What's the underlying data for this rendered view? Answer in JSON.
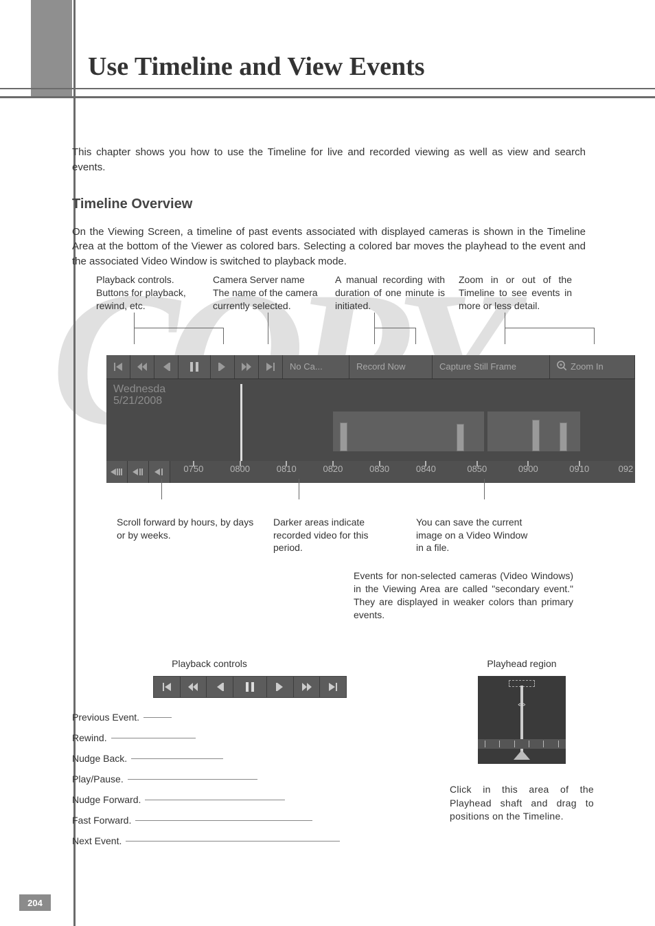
{
  "page": {
    "number": "204",
    "title": "Use Timeline and View Events",
    "watermark": "COPY"
  },
  "intro": "This chapter shows you how to use the Timeline for live and recorded viewing as well as view and search events.",
  "section": {
    "heading": "Timeline Overview",
    "body": "On the Viewing Screen, a timeline of past events associated with displayed cameras is shown in the Timeline Area at the bottom of the Viewer as colored bars. Selecting a colored bar moves the playhead to the event and the associated Video Window is switched to playback mode."
  },
  "callouts_top": {
    "playback": "Playback controls. Buttons for playback, rewind, etc.",
    "camera_name": "Camera Server name\nThe name of the camera currently selected.",
    "record_now": "A manual recording with duration of one minute is initiated.",
    "zoom": "Zoom in or out of the Timeline to see events in more or less detail."
  },
  "timeline": {
    "camera_label": "No Ca...",
    "record_now_label": "Record Now",
    "capture_label": "Capture Still Frame",
    "zoom_label": "Zoom In",
    "date_day": "Wednesda",
    "date_full": "5/21/2008",
    "ticks": [
      "0750",
      "0800",
      "0810",
      "0820",
      "0830",
      "0840",
      "0850",
      "0900",
      "0910",
      "092"
    ]
  },
  "callouts_bottom": {
    "scroll": "Scroll forward by hours, by days or by weeks.",
    "darker": "Darker areas indicate recorded video for this period.",
    "save": "You can save the current image on a Video Window in a file."
  },
  "secondary_note": "Events for non-selected cameras (Video Windows) in the Viewing Area are called \"secondary event.\" They are displayed in weaker colors than primary events.",
  "lower": {
    "playback_title": "Playback controls",
    "labels": {
      "prev_event": "Previous Event.",
      "rewind": "Rewind.",
      "nudge_back": "Nudge Back.",
      "play_pause": "Play/Pause.",
      "nudge_fwd": "Nudge Forward.",
      "fast_fwd": "Fast Forward.",
      "next_event": "Next Event."
    },
    "playhead_title": "Playhead region",
    "playhead_caption": "Click in this area of the Playhead shaft and drag to positions on the Timeline."
  }
}
